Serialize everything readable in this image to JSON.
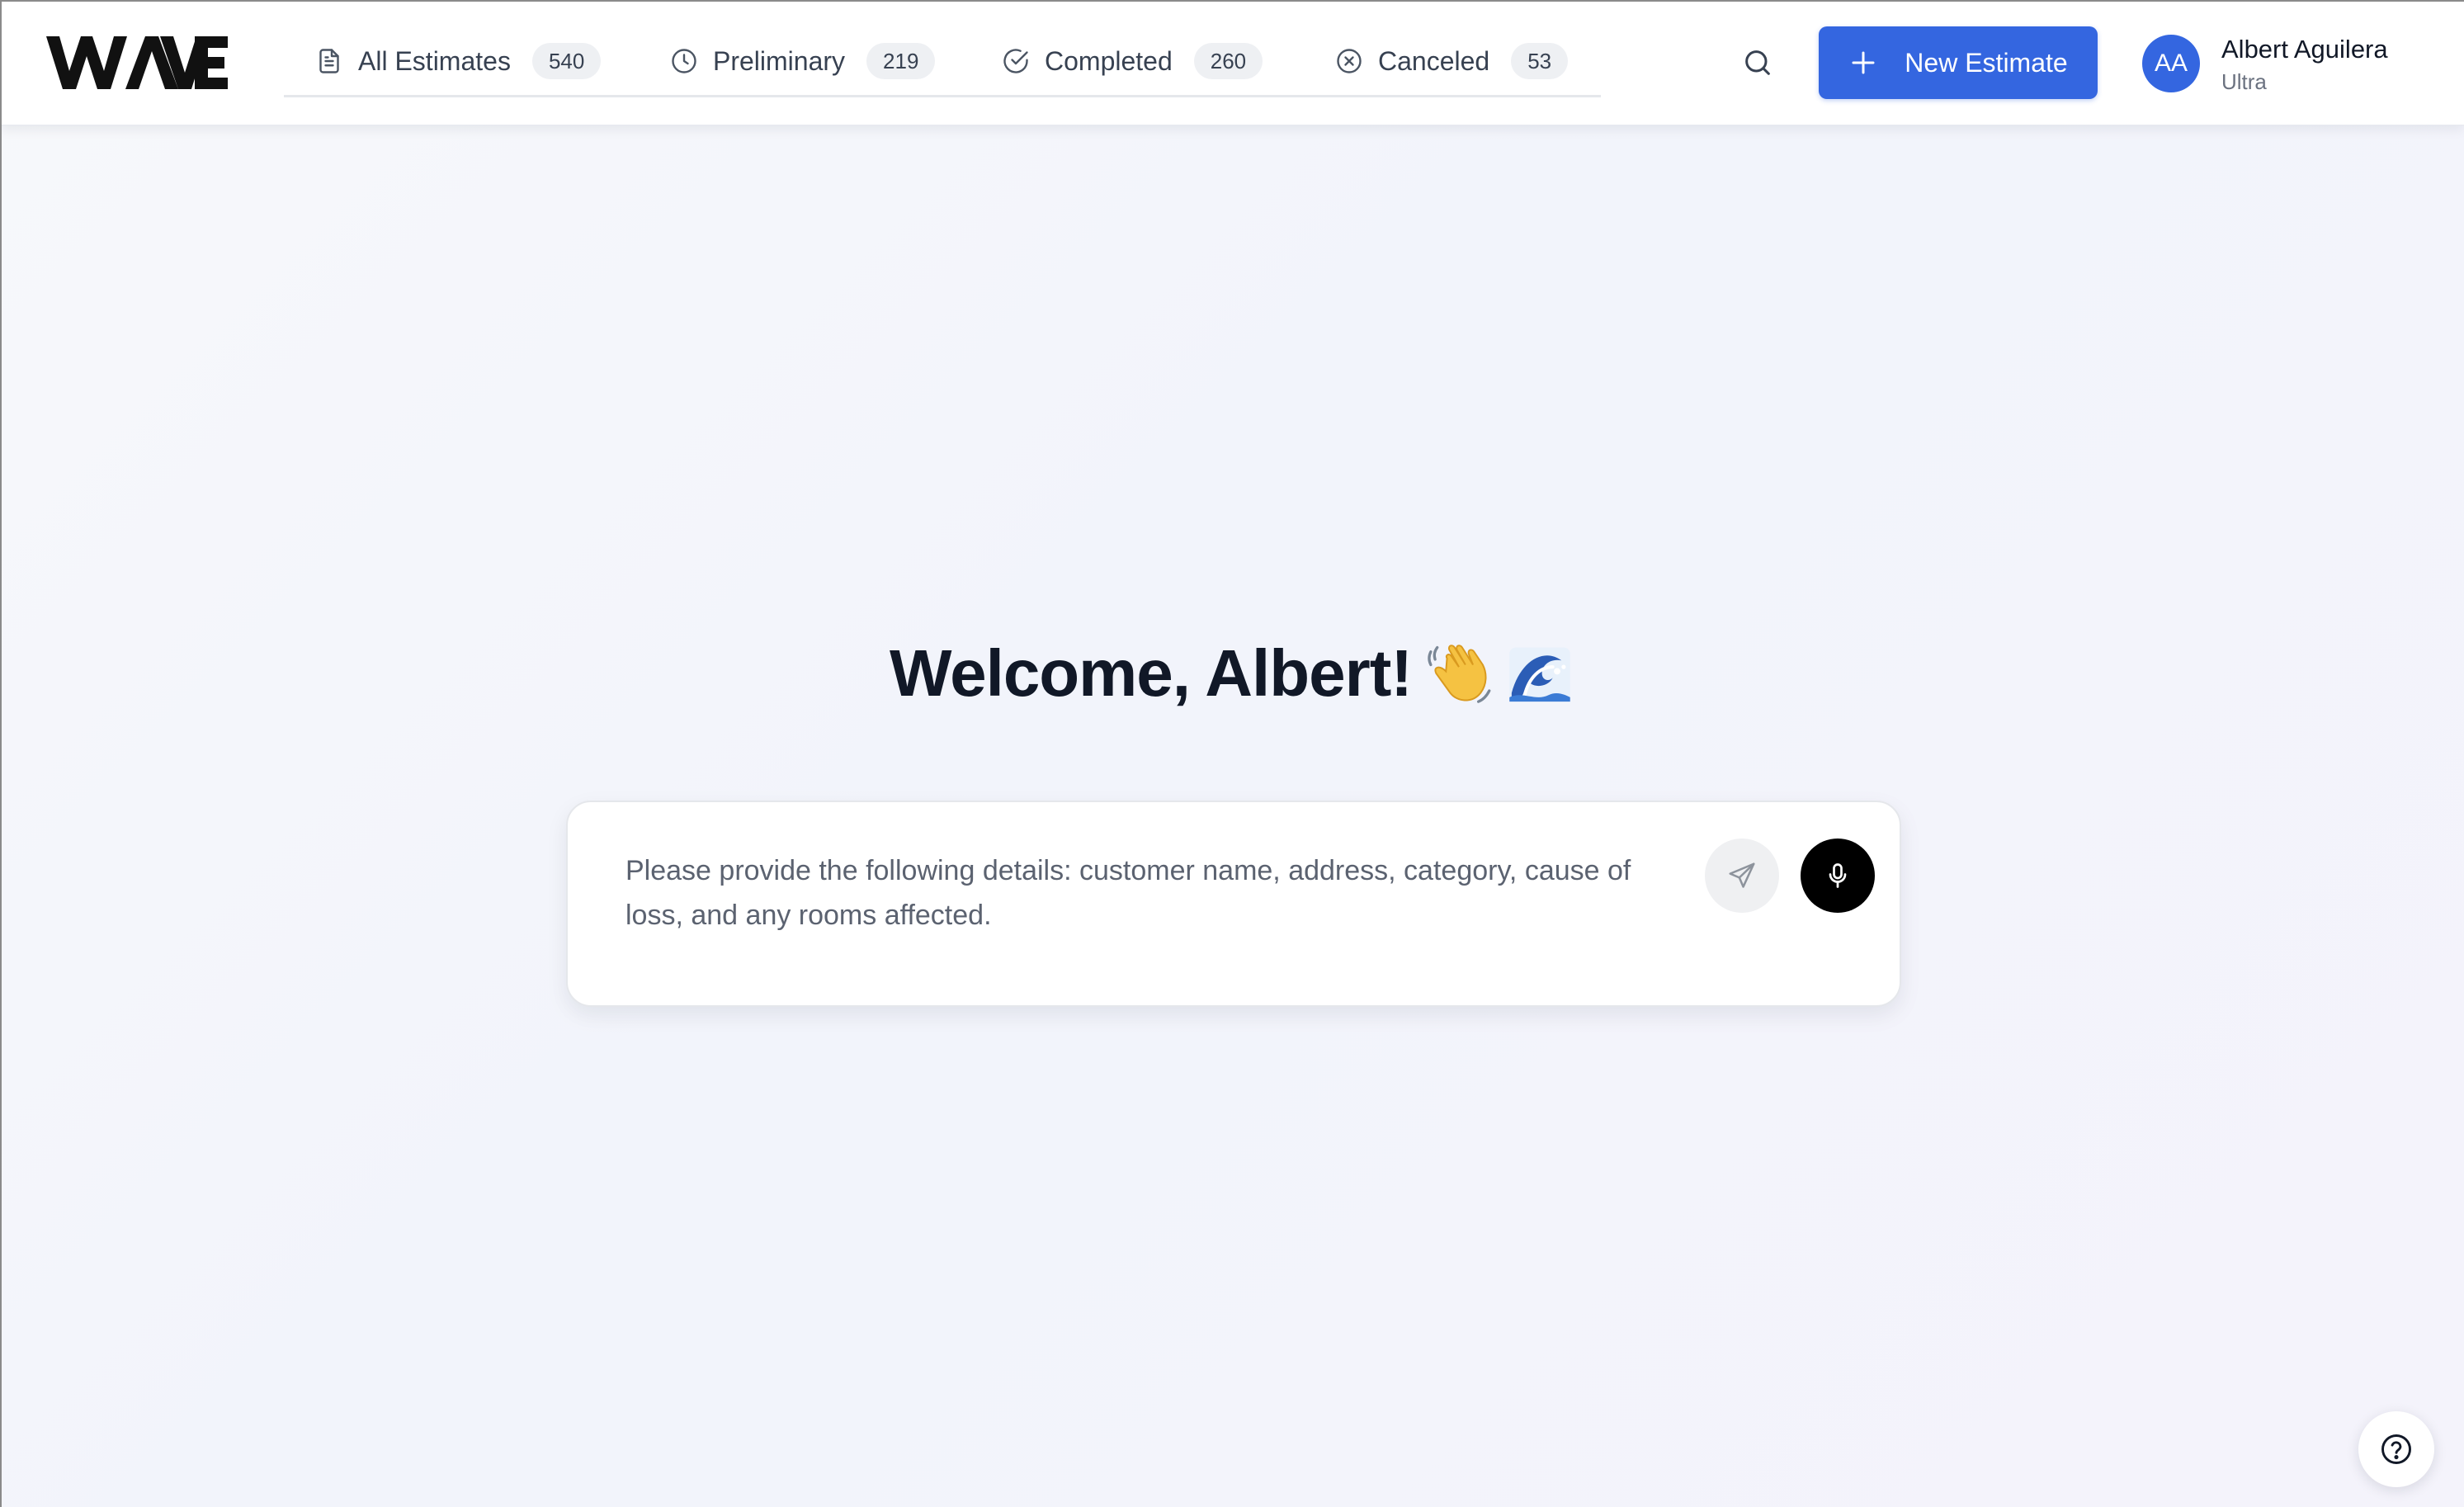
{
  "app": {
    "logo_text": "WAVE",
    "accent_color": "#3466e0"
  },
  "tabs": [
    {
      "label": "All Estimates",
      "count": "540",
      "icon": "document-icon"
    },
    {
      "label": "Preliminary",
      "count": "219",
      "icon": "clock-icon"
    },
    {
      "label": "Completed",
      "count": "260",
      "icon": "check-circle-icon"
    },
    {
      "label": "Canceled",
      "count": "53",
      "icon": "x-circle-icon"
    }
  ],
  "header": {
    "search_icon": "search-icon",
    "new_button_label": "New Estimate",
    "new_button_icon": "plus-icon"
  },
  "user": {
    "initials": "AA",
    "name": "Albert Aguilera",
    "plan": "Ultra"
  },
  "main": {
    "welcome": "Welcome, Albert!",
    "welcome_emojis": [
      "waving-hand-emoji",
      "water-wave-emoji"
    ],
    "prompt_placeholder": "Please provide the following details: customer name, address, category, cause of loss, and any rooms affected.",
    "send_icon": "send-icon",
    "mic_icon": "microphone-icon"
  },
  "help": {
    "icon": "help-icon"
  }
}
